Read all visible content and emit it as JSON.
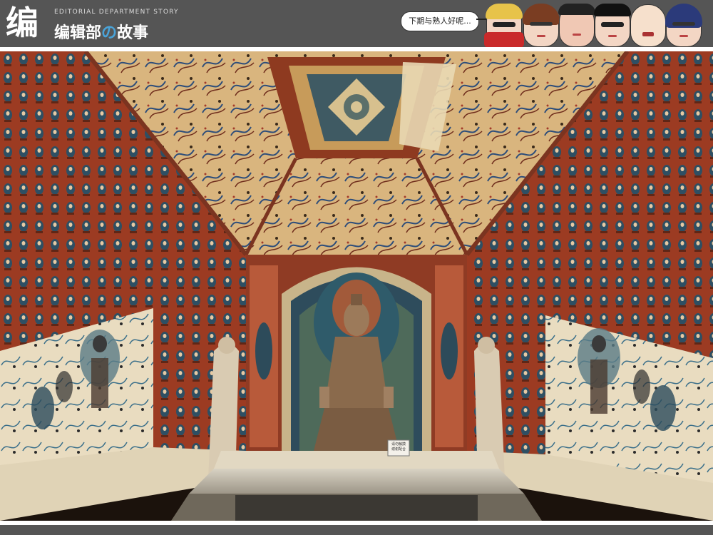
{
  "header": {
    "logo_glyph": "编",
    "subtitle": "EDITORIAL DEPARTMENT STORY",
    "title_part1": "编辑部",
    "title_accent": "の",
    "title_part2": "故事",
    "speech_text": "下期与熟人好呢..."
  },
  "caption": {
    "line1": "请勿触摸",
    "line2": "谢谢配合"
  },
  "icons": {
    "logo": "logo-icon",
    "faces": [
      "cartoon-face-scarf",
      "cartoon-face-woman",
      "cartoon-face-man",
      "cartoon-face-glasses",
      "cartoon-face-bald",
      "cartoon-face-girl"
    ]
  },
  "colors": {
    "header_bg": "#555555",
    "accent": "#4aa3d8",
    "cave_red": "#9c3b22",
    "ceiling": "#d8b47a"
  }
}
